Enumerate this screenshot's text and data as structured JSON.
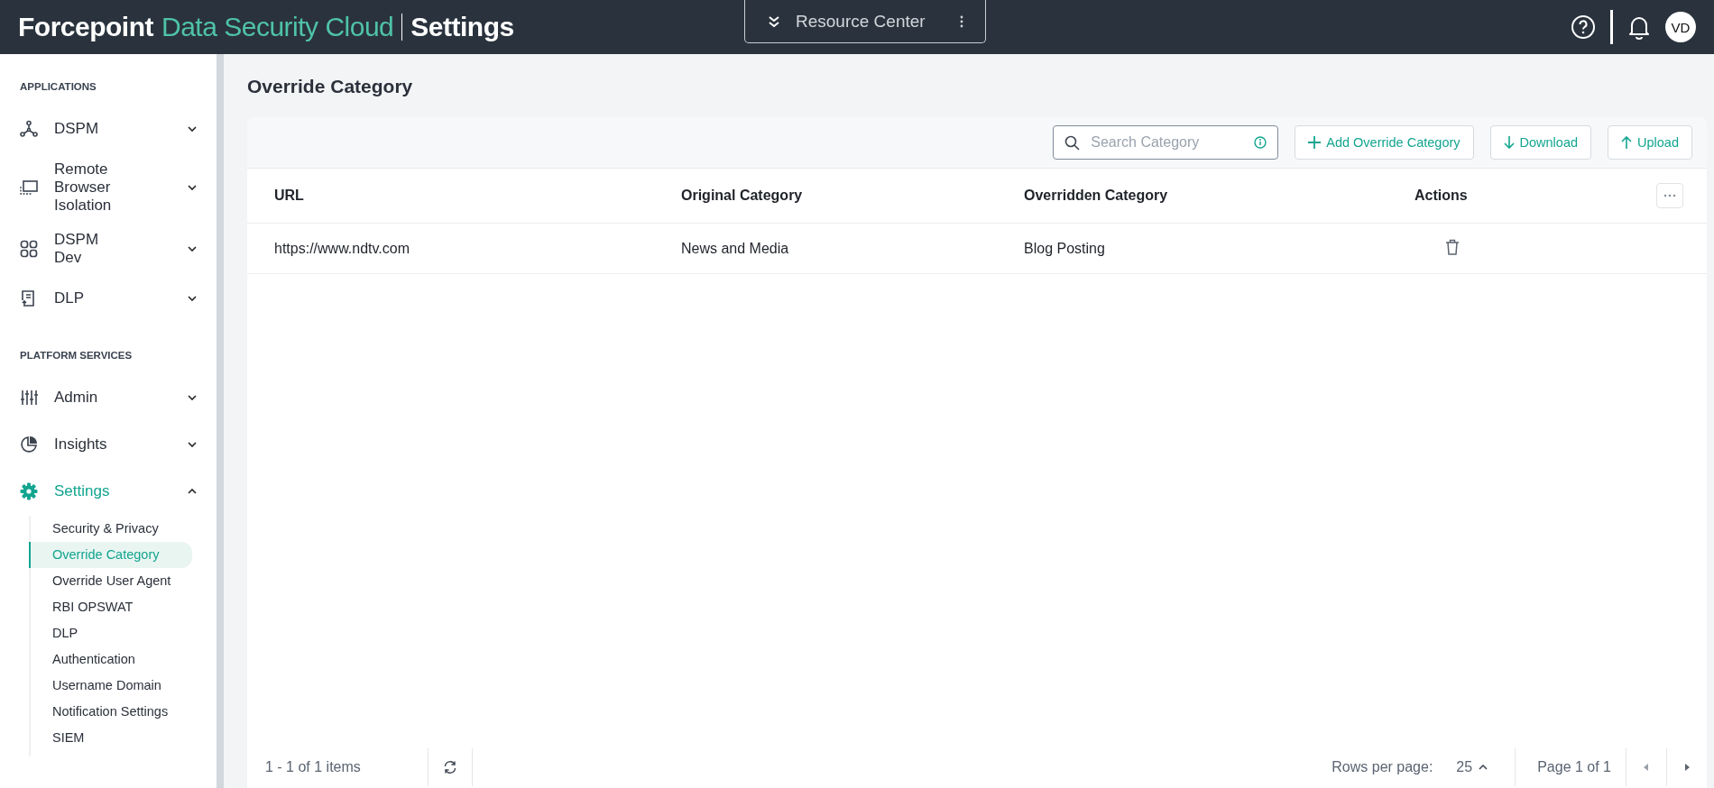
{
  "header": {
    "brand": "Forcepoint",
    "product": "Data Security Cloud",
    "section": "Settings",
    "resource_center": "Resource Center",
    "avatar": "VD"
  },
  "sidebar": {
    "groups": [
      {
        "heading": "APPLICATIONS",
        "items": [
          {
            "label": "DSPM",
            "expanded": false,
            "selected": false
          },
          {
            "label": "Remote Browser Isolation",
            "expanded": false,
            "selected": false
          },
          {
            "label": "DSPM Dev",
            "expanded": false,
            "selected": false
          },
          {
            "label": "DLP",
            "expanded": false,
            "selected": false
          }
        ]
      },
      {
        "heading": "PLATFORM SERVICES",
        "items": [
          {
            "label": "Admin",
            "expanded": false,
            "selected": false
          },
          {
            "label": "Insights",
            "expanded": false,
            "selected": false
          },
          {
            "label": "Settings",
            "expanded": true,
            "selected": true,
            "children": [
              {
                "label": "Security & Privacy",
                "selected": false
              },
              {
                "label": "Override Category",
                "selected": true
              },
              {
                "label": "Override User Agent",
                "selected": false
              },
              {
                "label": "RBI OPSWAT",
                "selected": false
              },
              {
                "label": "DLP",
                "selected": false
              },
              {
                "label": "Authentication",
                "selected": false
              },
              {
                "label": "Username Domain",
                "selected": false
              },
              {
                "label": "Notification Settings",
                "selected": false
              },
              {
                "label": "SIEM",
                "selected": false
              }
            ]
          }
        ]
      }
    ]
  },
  "page": {
    "title": "Override Category"
  },
  "toolbar": {
    "search": {
      "placeholder": "Search Category"
    },
    "buttons": [
      {
        "label": "Add Override Category",
        "kind": "add"
      },
      {
        "label": "Download",
        "kind": "download"
      },
      {
        "label": "Upload",
        "kind": "upload"
      }
    ]
  },
  "table": {
    "columns": [
      "URL",
      "Original Category",
      "Overridden Category",
      "Actions"
    ],
    "rows": [
      {
        "cells": [
          "https://www.ndtv.com",
          "News and Media",
          "Blog Posting"
        ]
      }
    ]
  },
  "footer": {
    "range": "1 - 1 of 1 items",
    "rows_per_page_label": "Rows per page:",
    "rows_per_page": "25",
    "page": "Page 1 of 1"
  }
}
